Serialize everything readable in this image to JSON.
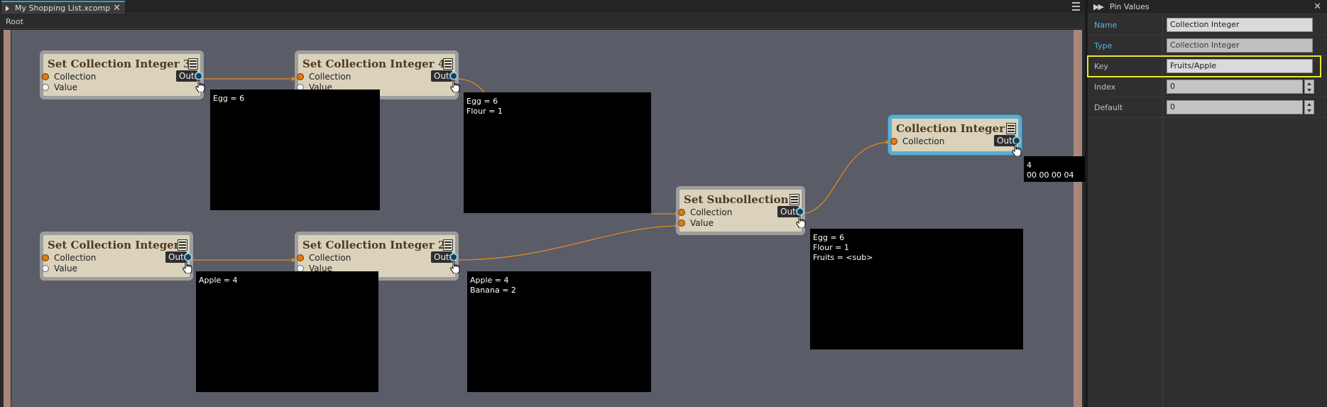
{
  "tab": {
    "title": "My Shopping List.xcomp",
    "close": "✕"
  },
  "breadcrumb": "Root",
  "nodes": [
    {
      "id": "n3",
      "title": "Set Collection Integer 3",
      "pins": [
        "Collection",
        "Value"
      ],
      "out": "Out"
    },
    {
      "id": "n4",
      "title": "Set Collection Integer 4",
      "pins": [
        "Collection",
        "Value"
      ],
      "out": "Out"
    },
    {
      "id": "n1",
      "title": "Set Collection Integer",
      "pins": [
        "Collection",
        "Value"
      ],
      "out": "Out"
    },
    {
      "id": "n2",
      "title": "Set Collection Integer 2",
      "pins": [
        "Collection",
        "Value"
      ],
      "out": "Out"
    },
    {
      "id": "ns",
      "title": "Set Subcollection",
      "pins": [
        "Collection",
        "Value"
      ],
      "out": "Out"
    },
    {
      "id": "nc",
      "title": "Collection Integer",
      "pins": [
        "Collection"
      ],
      "out": "Out"
    }
  ],
  "tooltips": {
    "n3": "Egg = 6",
    "n4": "Egg = 6\nFlour = 1",
    "n1": "Apple = 4",
    "n2": "Apple = 4\nBanana = 2",
    "ns": "Egg = 6\nFlour = 1\nFruits = <sub>",
    "nc": "4\n00 00 00 04"
  },
  "panel": {
    "title": "Pin Values",
    "close": "✕",
    "properties": [
      {
        "label": "Name",
        "value": "Collection Integer"
      },
      {
        "label": "Type",
        "value": "Collection Integer"
      },
      {
        "label": "Key",
        "value": "Fruits/Apple"
      },
      {
        "label": "Index",
        "value": "0"
      },
      {
        "label": "Default",
        "value": "0"
      }
    ]
  },
  "colors": {
    "wire": "#e08a1a",
    "selected_node": "#5aaed0",
    "highlight": "#ebe82b",
    "label_blue": "#55b4e8"
  }
}
